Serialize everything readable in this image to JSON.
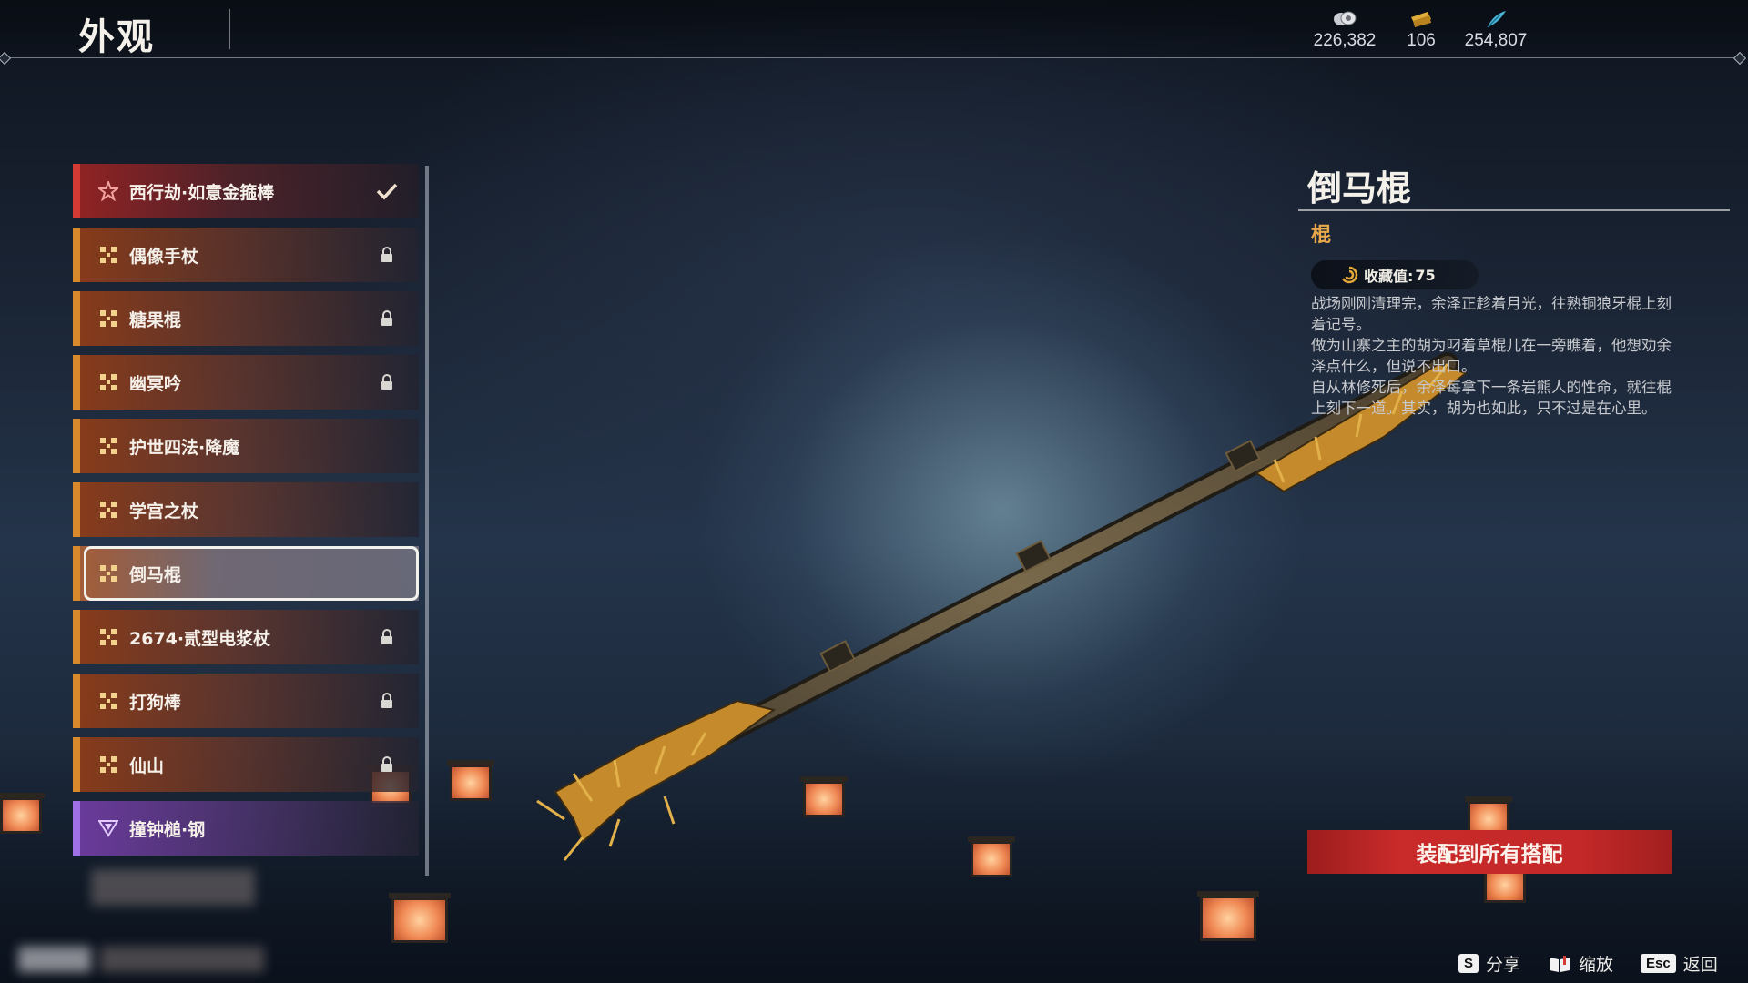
{
  "header": {
    "title": "外观",
    "currencies": [
      {
        "icon": "coin-stack-icon",
        "value": "226,382"
      },
      {
        "icon": "gold-ticket-icon",
        "value": "106"
      },
      {
        "icon": "blue-feather-icon",
        "value": "254,807"
      }
    ]
  },
  "list": {
    "items": [
      {
        "label": "西行劫·如意金箍棒",
        "rarity_color": "#d23a33",
        "icon": "star-icon",
        "status": "equipped-check-icon"
      },
      {
        "label": "偶像手杖",
        "rarity_color": "#d8892c",
        "icon": "cross-pattern-icon",
        "status": "lock-icon"
      },
      {
        "label": "糖果棍",
        "rarity_color": "#d8892c",
        "icon": "cross-pattern-icon",
        "status": "lock-icon"
      },
      {
        "label": "幽冥吟",
        "rarity_color": "#d8892c",
        "icon": "cross-pattern-icon",
        "status": "lock-icon"
      },
      {
        "label": "护世四法·降魔",
        "rarity_color": "#d8892c",
        "icon": "cross-pattern-icon",
        "status": ""
      },
      {
        "label": "学宫之杖",
        "rarity_color": "#d8892c",
        "icon": "cross-pattern-icon",
        "status": ""
      },
      {
        "label": "倒马棍",
        "rarity_color": "#d8892c",
        "icon": "cross-pattern-icon",
        "status": "",
        "selected": true
      },
      {
        "label": "2674·贰型电浆杖",
        "rarity_color": "#d8892c",
        "icon": "cross-pattern-icon",
        "status": "lock-icon"
      },
      {
        "label": "打狗棒",
        "rarity_color": "#d8892c",
        "icon": "cross-pattern-icon",
        "status": "lock-icon"
      },
      {
        "label": "仙山",
        "rarity_color": "#d8892c",
        "icon": "cross-pattern-icon",
        "status": "lock-icon"
      },
      {
        "label": "撞钟槌·钢",
        "rarity_color": "#a071e6",
        "icon": "triangle-pattern-icon",
        "status": ""
      }
    ]
  },
  "detail": {
    "name": "倒马棍",
    "type": "棍",
    "collection_label": "收藏值:",
    "collection_value": "75",
    "description": [
      "战场刚刚清理完，余泽正趁着月光，往熟铜狼牙棍上刻着记号。",
      "做为山寨之主的胡为叼着草棍儿在一旁瞧着，他想劝余泽点什么，但说不出口。",
      "自从林修死后，余泽每拿下一条岩熊人的性命，就往棍上刻下一道。其实，胡为也如此，只不过是在心里。"
    ],
    "equip_button": "装配到所有搭配"
  },
  "footer": {
    "hints": [
      {
        "key": "S",
        "label": "分享"
      },
      {
        "key": "book-icon",
        "label": "缩放"
      },
      {
        "key": "Esc",
        "label": "返回"
      }
    ]
  },
  "colors": {
    "accent_orange": "#d8892c",
    "accent_red": "#d23a33",
    "accent_purple": "#a071e6",
    "gold_text": "#e7a94a",
    "button_red": "#c42828"
  }
}
